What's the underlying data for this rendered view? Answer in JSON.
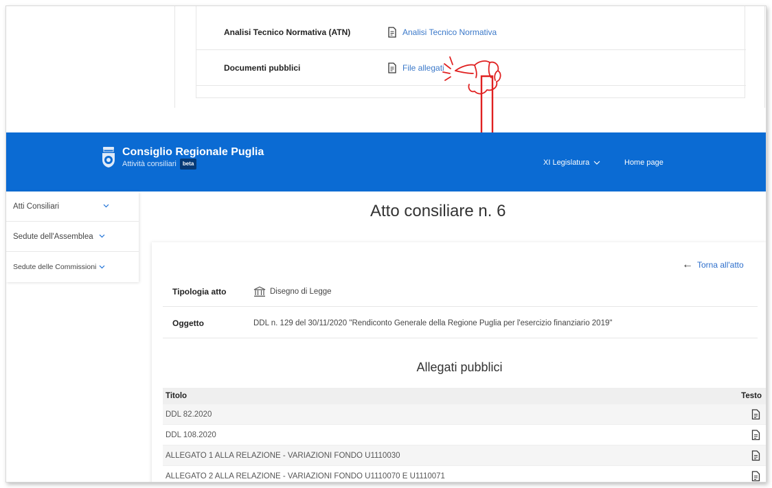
{
  "snippet": {
    "rows": [
      {
        "label": "Analisi Tecnico Normativa (ATN)",
        "link": "Analisi Tecnico Normativa"
      },
      {
        "label": "Documenti pubblici",
        "link": "File allegati"
      }
    ]
  },
  "header": {
    "title": "Consiglio Regionale Puglia",
    "subtitle": "Attività consiliari",
    "badge": "beta",
    "legislatura": "XI Legislatura",
    "home": "Home page",
    "color": "#0b6bd3"
  },
  "sidebar": {
    "items": [
      {
        "label": "Atti Consiliari"
      },
      {
        "label": "Sedute dell'Assemblea"
      },
      {
        "label": "Sedute delle Commissioni"
      }
    ]
  },
  "main": {
    "title": "Atto consiliare n. 6",
    "back_link": "Torna all'atto",
    "tipologia_label": "Tipologia atto",
    "tipologia_value": "Disegno di Legge",
    "oggetto_label": "Oggetto",
    "oggetto_value": "DDL n. 129 del 30/11/2020 \"Rendiconto Generale della Regione Puglia per l'esercizio finanziario 2019\"",
    "section_title": "Allegati pubblici",
    "table": {
      "col_title": "Titolo",
      "col_text": "Testo",
      "rows": [
        "DDL 82.2020",
        "DDL 108.2020",
        "ALLEGATO 1 ALLA RELAZIONE - VARIAZIONI FONDO U1110030",
        "ALLEGATO 2 ALLA RELAZIONE - VARIAZIONI FONDO U1110070 E U1110071"
      ]
    }
  },
  "icons": {
    "file": "file-icon",
    "building": "institution-icon",
    "chevron": "chevron-down-icon",
    "back": "arrow-left-icon",
    "hand": "pointing-hand-icon",
    "arrow": "red-down-arrow"
  },
  "accent_red": "#e02020"
}
